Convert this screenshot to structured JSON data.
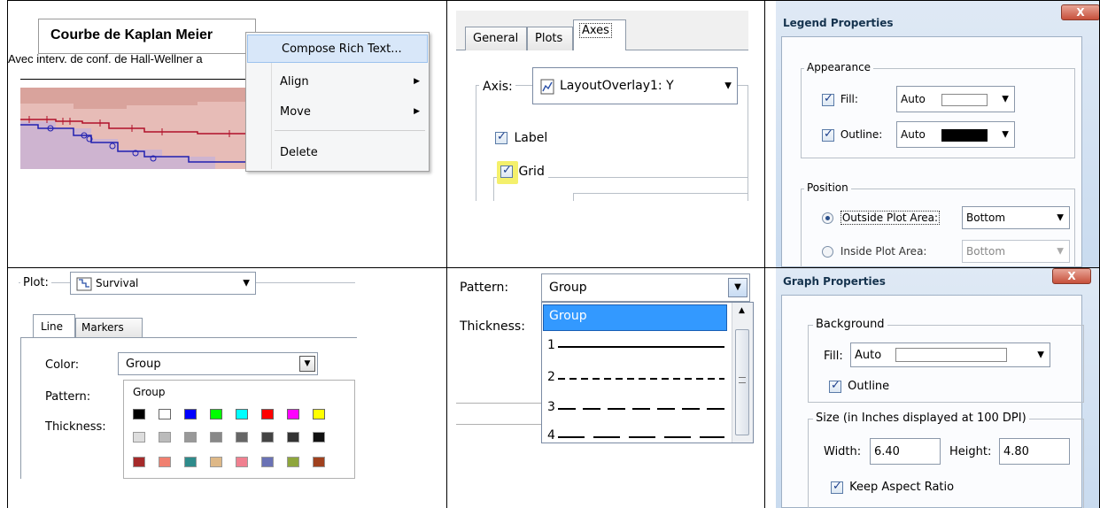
{
  "panel_kaplan": {
    "title": "Courbe de Kaplan Meier",
    "subtitle": "Avec interv. de conf. de Hall-Wellner a",
    "menu": [
      "Compose Rich Text...",
      "Align",
      "Move",
      "Delete"
    ]
  },
  "panel_axes": {
    "tabs": [
      "General",
      "Plots",
      "Axes"
    ],
    "axis_label": "Axis:",
    "axis_value": "LayoutOverlay1: Y",
    "label_checkbox": "Label",
    "grid_checkbox": "Grid"
  },
  "panel_legend": {
    "title": "Legend Properties",
    "close": "X",
    "appearance": "Appearance",
    "fill_label": "Fill:",
    "fill_value": "Auto",
    "outline_label": "Outline:",
    "outline_value": "Auto",
    "position": "Position",
    "outside_label": "Outside Plot Area:",
    "outside_value": "Bottom",
    "inside_label": "Inside Plot Area:",
    "inside_value": "Bottom"
  },
  "panel_plot": {
    "plot_label": "Plot:",
    "plot_value": "Survival",
    "tabs": [
      "Line",
      "Markers"
    ],
    "color_label": "Color:",
    "color_value": "Group",
    "pattern_label": "Pattern:",
    "thickness_label": "Thickness:",
    "palette_header": "Group",
    "palette_row1": [
      "#000000",
      "#ffffff",
      "#0000ff",
      "#00ff00",
      "#00ffff",
      "#ff0000",
      "#ff00ff",
      "#ffff00"
    ],
    "palette_row2": [
      "#dddddd",
      "#bbbbbb",
      "#999999",
      "#888888",
      "#666666",
      "#444444",
      "#333333",
      "#111111"
    ],
    "palette_row3": [
      "#a52a2a",
      "#f08070",
      "#2e8b8b",
      "#deb887",
      "#f08090",
      "#6a72b5",
      "#8ea63c",
      "#a0411e"
    ]
  },
  "panel_pattern": {
    "pattern_label": "Pattern:",
    "pattern_value": "Group",
    "thickness_label": "Thickness:",
    "options": [
      "Group",
      "1",
      "2",
      "3",
      "4"
    ]
  },
  "panel_graph": {
    "title": "Graph Properties",
    "close": "X",
    "background": "Background",
    "fill_label": "Fill:",
    "fill_value": "Auto",
    "outline_label": "Outline",
    "size_label": "Size (in Inches displayed at 100 DPI)",
    "width_label": "Width:",
    "width_value": "6.40",
    "height_label": "Height:",
    "height_value": "4.80",
    "keep_ratio": "Keep Aspect Ratio"
  }
}
